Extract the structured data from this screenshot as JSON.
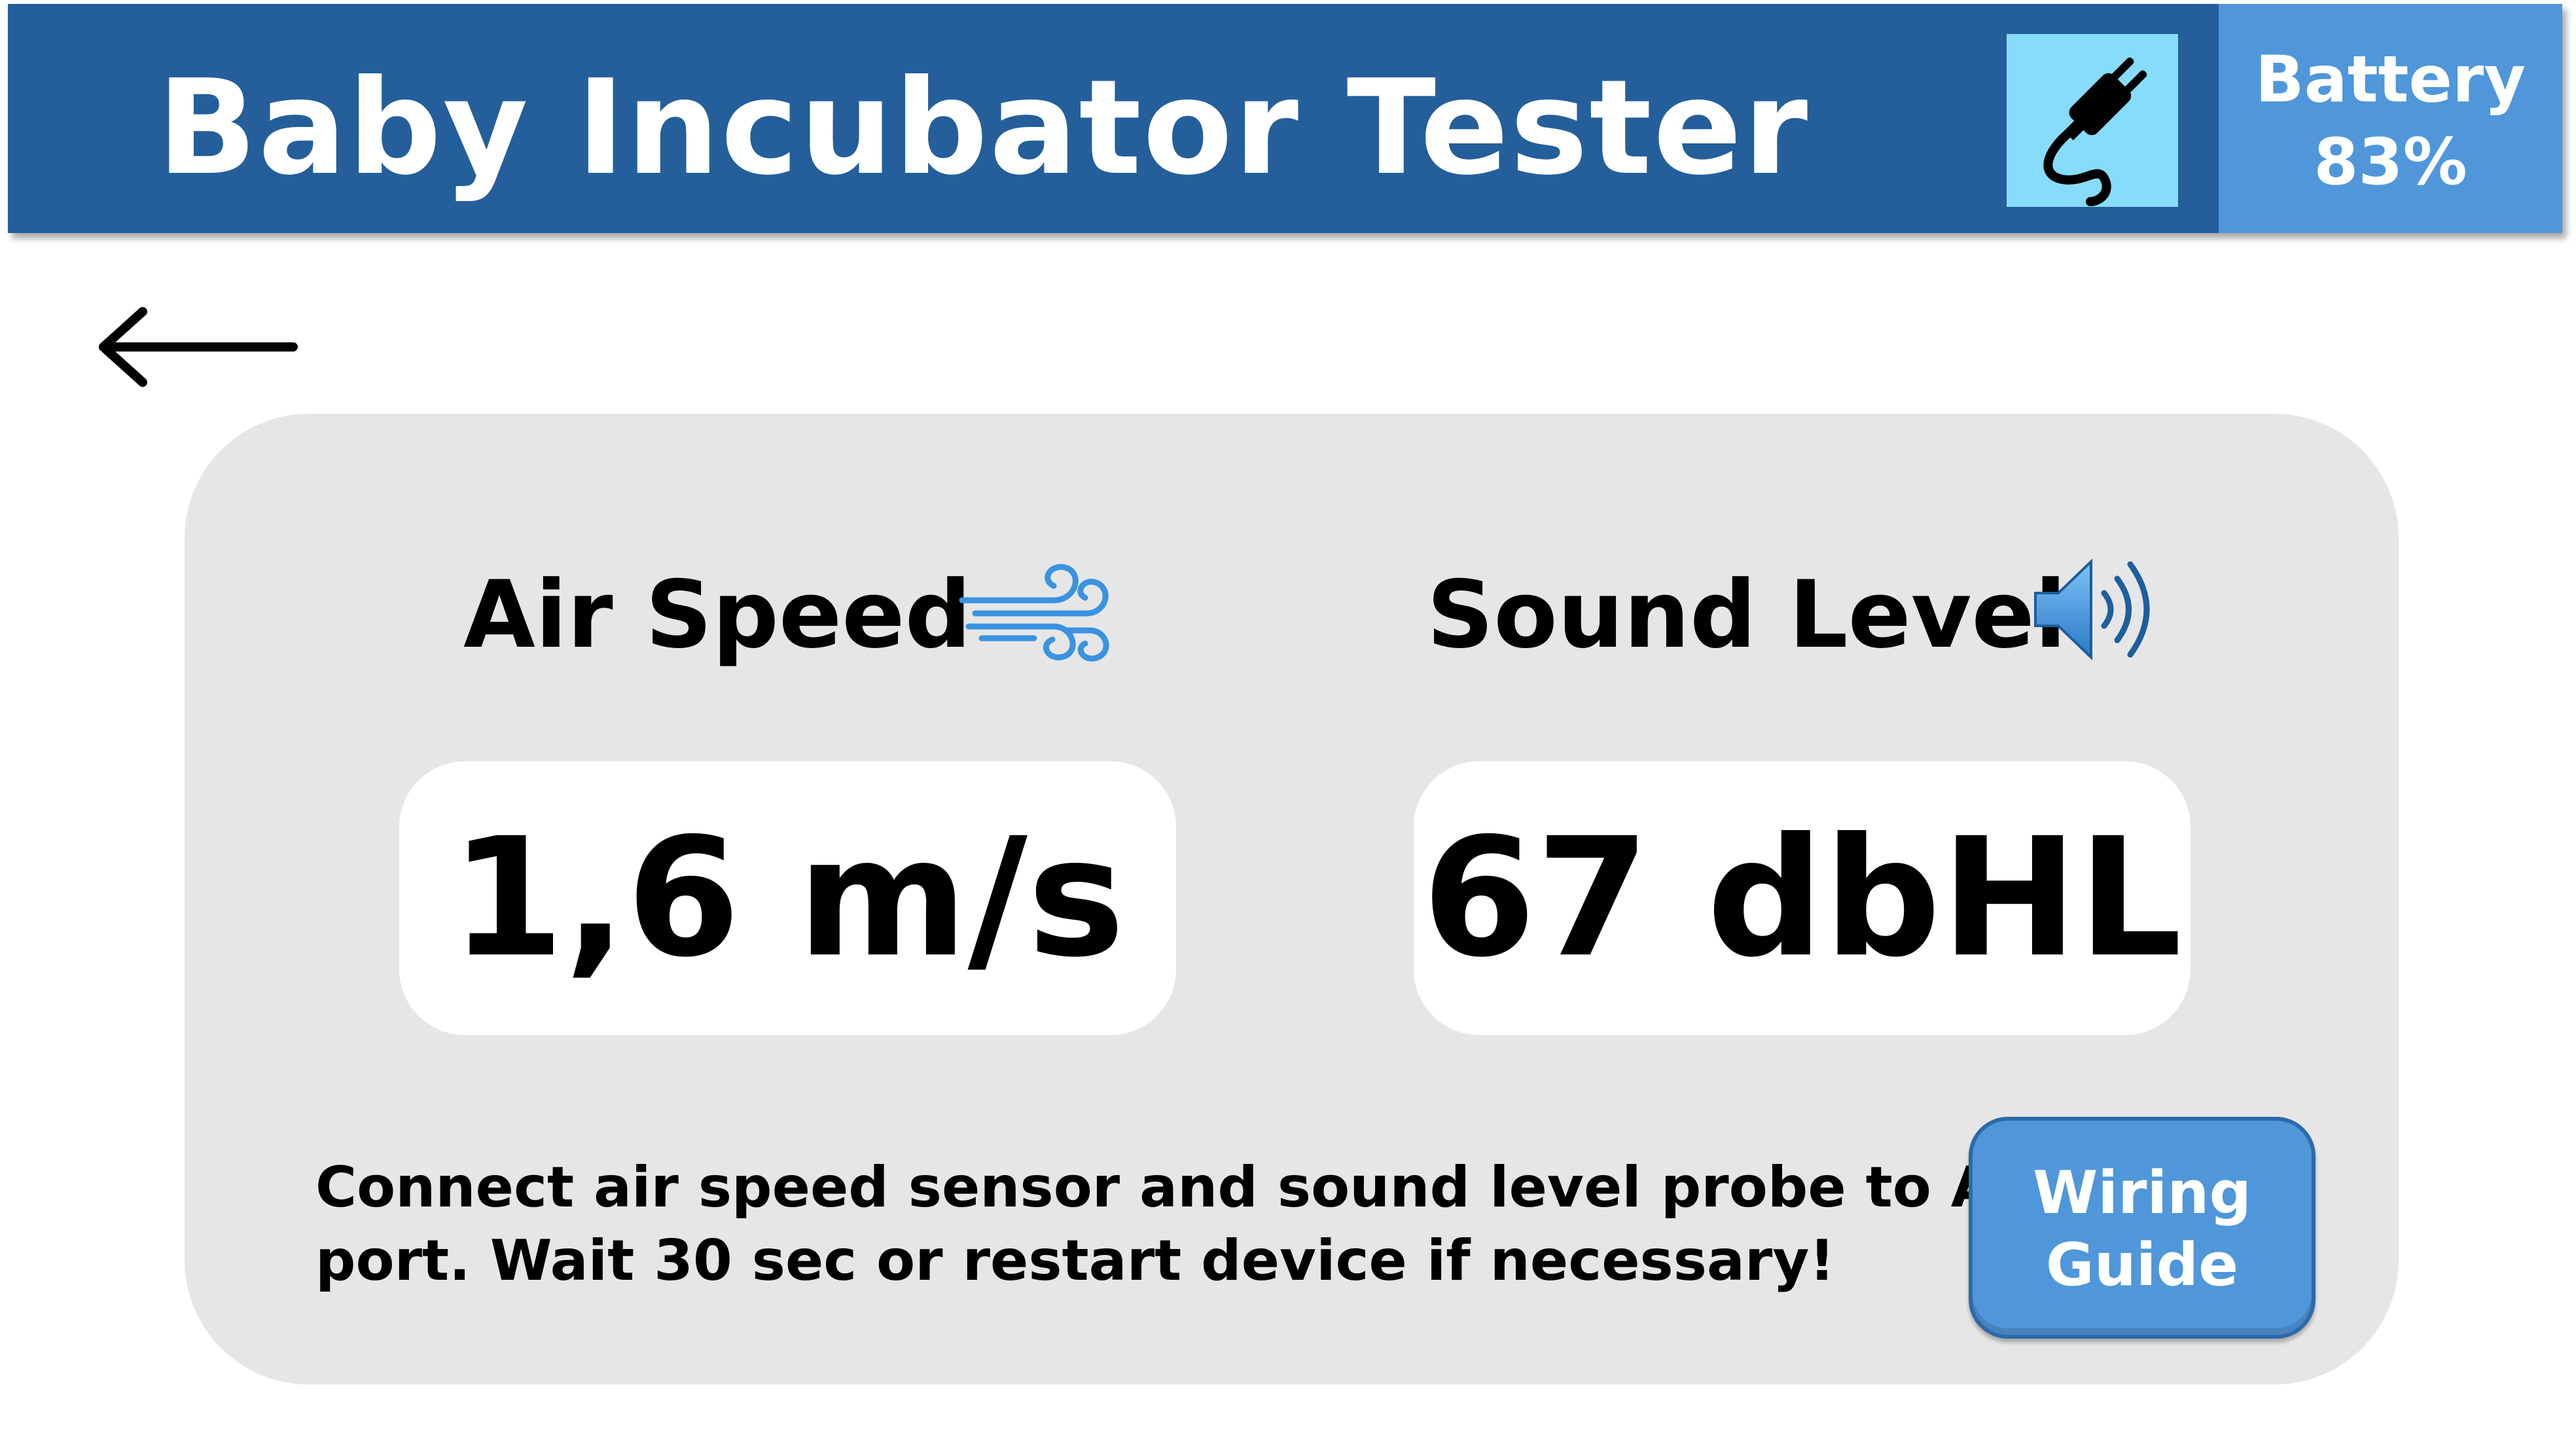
{
  "header": {
    "title": "Baby Incubator Tester",
    "power_icon": "plug-icon",
    "battery_label": "Battery",
    "battery_value": "83%"
  },
  "nav": {
    "back_icon": "arrow-left-icon"
  },
  "metrics": {
    "air_speed": {
      "label": "Air Speed",
      "icon": "wind-icon",
      "value": "1,6 m/s"
    },
    "sound_level": {
      "label": "Sound Level",
      "icon": "speaker-icon",
      "value": "67 dbHL"
    }
  },
  "instructions": {
    "line1": "Connect air speed sensor and sound level probe to Aux",
    "line2": "port. Wait 30 sec or restart device if necessary!"
  },
  "wiring_button": {
    "line1": "Wiring",
    "line2": "Guide"
  },
  "colors": {
    "header_bg": "#245f9b",
    "battery_bg": "#4f97da",
    "plug_bg": "#87dcfb",
    "panel_bg": "#e6e6e6",
    "button_bg": "#4f97da"
  }
}
